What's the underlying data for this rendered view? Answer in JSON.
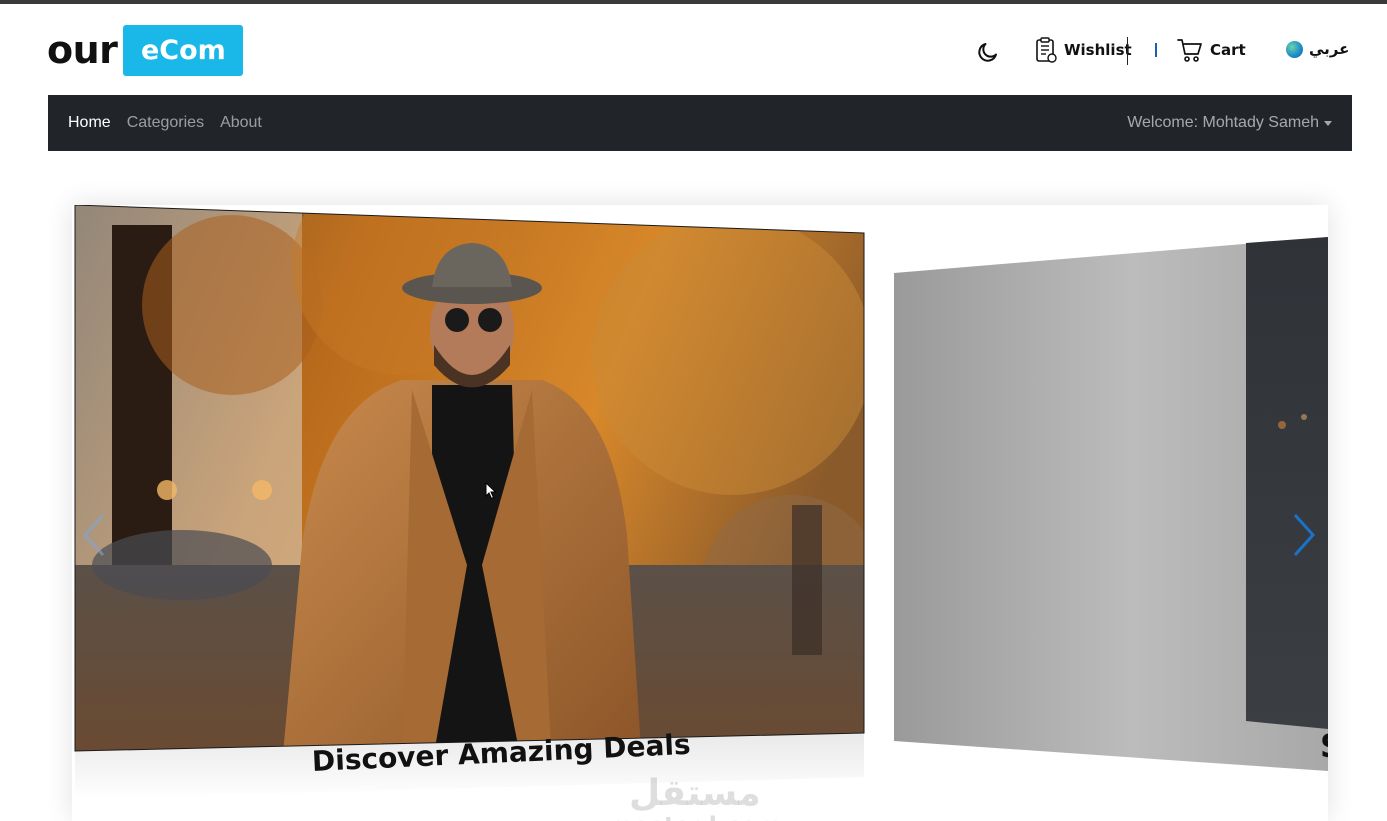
{
  "brand": {
    "prefix": "our",
    "badge": "eCom",
    "badge_color": "#1ab8e8"
  },
  "header": {
    "theme_icon": "moon-icon",
    "wishlist_label": "Wishlist",
    "cart_label": "Cart",
    "language_label": "عربي"
  },
  "navbar": {
    "background": "#212529",
    "links": [
      {
        "label": "Home",
        "active": true
      },
      {
        "label": "Categories",
        "active": false
      },
      {
        "label": "About",
        "active": false
      }
    ],
    "user_menu": "Welcome: Mohtady Sameh"
  },
  "carousel": {
    "active_caption": "Discover Amazing Deals",
    "next_caption_partial": "S",
    "controls": {
      "prev": "chevron-left-icon",
      "next": "chevron-right-icon"
    },
    "accent": "#1a73c8"
  },
  "watermark": {
    "arabic": "مستقل",
    "latin": "mostaql.com"
  }
}
